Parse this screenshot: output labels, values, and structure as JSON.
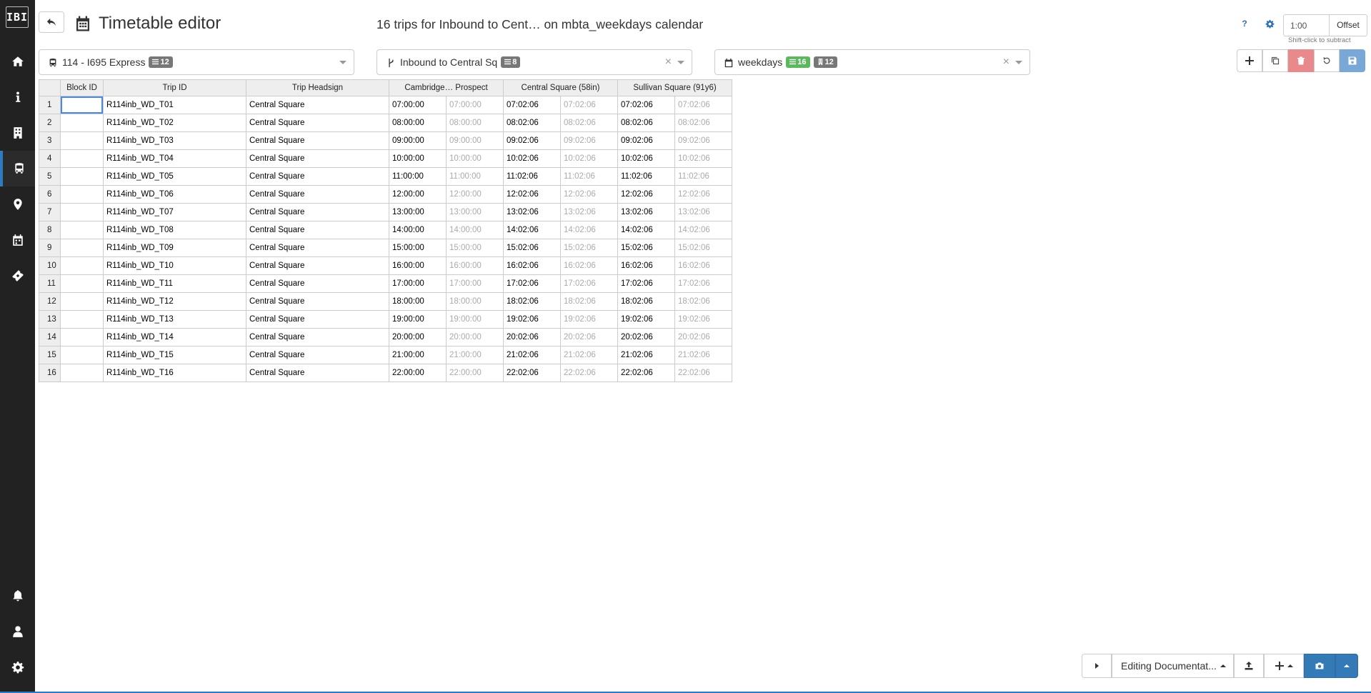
{
  "sidebar": {
    "logo": "IBI",
    "items": [
      {
        "name": "home-icon"
      },
      {
        "name": "info-icon"
      },
      {
        "name": "building-icon"
      },
      {
        "name": "bus-icon",
        "active": true
      },
      {
        "name": "map-marker-icon"
      },
      {
        "name": "calendar-icon"
      },
      {
        "name": "ticket-icon"
      }
    ],
    "bottom_items": [
      {
        "name": "bell-icon"
      },
      {
        "name": "user-icon"
      },
      {
        "name": "gear-icon"
      }
    ]
  },
  "header": {
    "title": "Timetable editor",
    "subtitle": "16 trips for Inbound to Cent… on mbta_weekdays calendar",
    "help_label": "?",
    "offset_value": "1:00",
    "offset_button": "Offset",
    "offset_hint": "Shift-click to subtract"
  },
  "selectors": {
    "route": {
      "label": "114 - I695 Express",
      "badge": "12"
    },
    "pattern": {
      "label": "Inbound to Central Sq",
      "badge": "8",
      "clear": "×"
    },
    "calendar": {
      "label": "weekdays",
      "badge_green": "16",
      "badge_gray": "12",
      "clear": "×"
    }
  },
  "colors": {
    "sidebar": "#222222",
    "accent": "#2f7bbf",
    "danger": "#e8898b",
    "primary": "#337ab7",
    "badge_green": "#5cb85c"
  },
  "table": {
    "headers": [
      "Block ID",
      "Trip ID",
      "Trip Headsign",
      "Cambridge… Prospect",
      "Central Square (58in)",
      "Sullivan Square (91y6)"
    ],
    "rows": [
      {
        "n": "1",
        "trip": "R114inb_WD_T01",
        "headsign": "Central Square",
        "t1": "07:00:00",
        "t1b": "07:00:00",
        "t2": "07:02:06",
        "t2b": "07:02:06",
        "t3": "07:02:06",
        "t3b": "07:02:06"
      },
      {
        "n": "2",
        "trip": "R114inb_WD_T02",
        "headsign": "Central Square",
        "t1": "08:00:00",
        "t1b": "08:00:00",
        "t2": "08:02:06",
        "t2b": "08:02:06",
        "t3": "08:02:06",
        "t3b": "08:02:06"
      },
      {
        "n": "3",
        "trip": "R114inb_WD_T03",
        "headsign": "Central Square",
        "t1": "09:00:00",
        "t1b": "09:00:00",
        "t2": "09:02:06",
        "t2b": "09:02:06",
        "t3": "09:02:06",
        "t3b": "09:02:06"
      },
      {
        "n": "4",
        "trip": "R114inb_WD_T04",
        "headsign": "Central Square",
        "t1": "10:00:00",
        "t1b": "10:00:00",
        "t2": "10:02:06",
        "t2b": "10:02:06",
        "t3": "10:02:06",
        "t3b": "10:02:06"
      },
      {
        "n": "5",
        "trip": "R114inb_WD_T05",
        "headsign": "Central Square",
        "t1": "11:00:00",
        "t1b": "11:00:00",
        "t2": "11:02:06",
        "t2b": "11:02:06",
        "t3": "11:02:06",
        "t3b": "11:02:06"
      },
      {
        "n": "6",
        "trip": "R114inb_WD_T06",
        "headsign": "Central Square",
        "t1": "12:00:00",
        "t1b": "12:00:00",
        "t2": "12:02:06",
        "t2b": "12:02:06",
        "t3": "12:02:06",
        "t3b": "12:02:06"
      },
      {
        "n": "7",
        "trip": "R114inb_WD_T07",
        "headsign": "Central Square",
        "t1": "13:00:00",
        "t1b": "13:00:00",
        "t2": "13:02:06",
        "t2b": "13:02:06",
        "t3": "13:02:06",
        "t3b": "13:02:06"
      },
      {
        "n": "8",
        "trip": "R114inb_WD_T08",
        "headsign": "Central Square",
        "t1": "14:00:00",
        "t1b": "14:00:00",
        "t2": "14:02:06",
        "t2b": "14:02:06",
        "t3": "14:02:06",
        "t3b": "14:02:06"
      },
      {
        "n": "9",
        "trip": "R114inb_WD_T09",
        "headsign": "Central Square",
        "t1": "15:00:00",
        "t1b": "15:00:00",
        "t2": "15:02:06",
        "t2b": "15:02:06",
        "t3": "15:02:06",
        "t3b": "15:02:06"
      },
      {
        "n": "10",
        "trip": "R114inb_WD_T10",
        "headsign": "Central Square",
        "t1": "16:00:00",
        "t1b": "16:00:00",
        "t2": "16:02:06",
        "t2b": "16:02:06",
        "t3": "16:02:06",
        "t3b": "16:02:06"
      },
      {
        "n": "11",
        "trip": "R114inb_WD_T11",
        "headsign": "Central Square",
        "t1": "17:00:00",
        "t1b": "17:00:00",
        "t2": "17:02:06",
        "t2b": "17:02:06",
        "t3": "17:02:06",
        "t3b": "17:02:06"
      },
      {
        "n": "12",
        "trip": "R114inb_WD_T12",
        "headsign": "Central Square",
        "t1": "18:00:00",
        "t1b": "18:00:00",
        "t2": "18:02:06",
        "t2b": "18:02:06",
        "t3": "18:02:06",
        "t3b": "18:02:06"
      },
      {
        "n": "13",
        "trip": "R114inb_WD_T13",
        "headsign": "Central Square",
        "t1": "19:00:00",
        "t1b": "19:00:00",
        "t2": "19:02:06",
        "t2b": "19:02:06",
        "t3": "19:02:06",
        "t3b": "19:02:06"
      },
      {
        "n": "14",
        "trip": "R114inb_WD_T14",
        "headsign": "Central Square",
        "t1": "20:00:00",
        "t1b": "20:00:00",
        "t2": "20:02:06",
        "t2b": "20:02:06",
        "t3": "20:02:06",
        "t3b": "20:02:06"
      },
      {
        "n": "15",
        "trip": "R114inb_WD_T15",
        "headsign": "Central Square",
        "t1": "21:00:00",
        "t1b": "21:00:00",
        "t2": "21:02:06",
        "t2b": "21:02:06",
        "t3": "21:02:06",
        "t3b": "21:02:06"
      },
      {
        "n": "16",
        "trip": "R114inb_WD_T16",
        "headsign": "Central Square",
        "t1": "22:00:00",
        "t1b": "22:00:00",
        "t2": "22:02:06",
        "t2b": "22:02:06",
        "t3": "22:02:06",
        "t3b": "22:02:06"
      }
    ]
  },
  "bottom": {
    "editing_label": "Editing Documentat..."
  }
}
